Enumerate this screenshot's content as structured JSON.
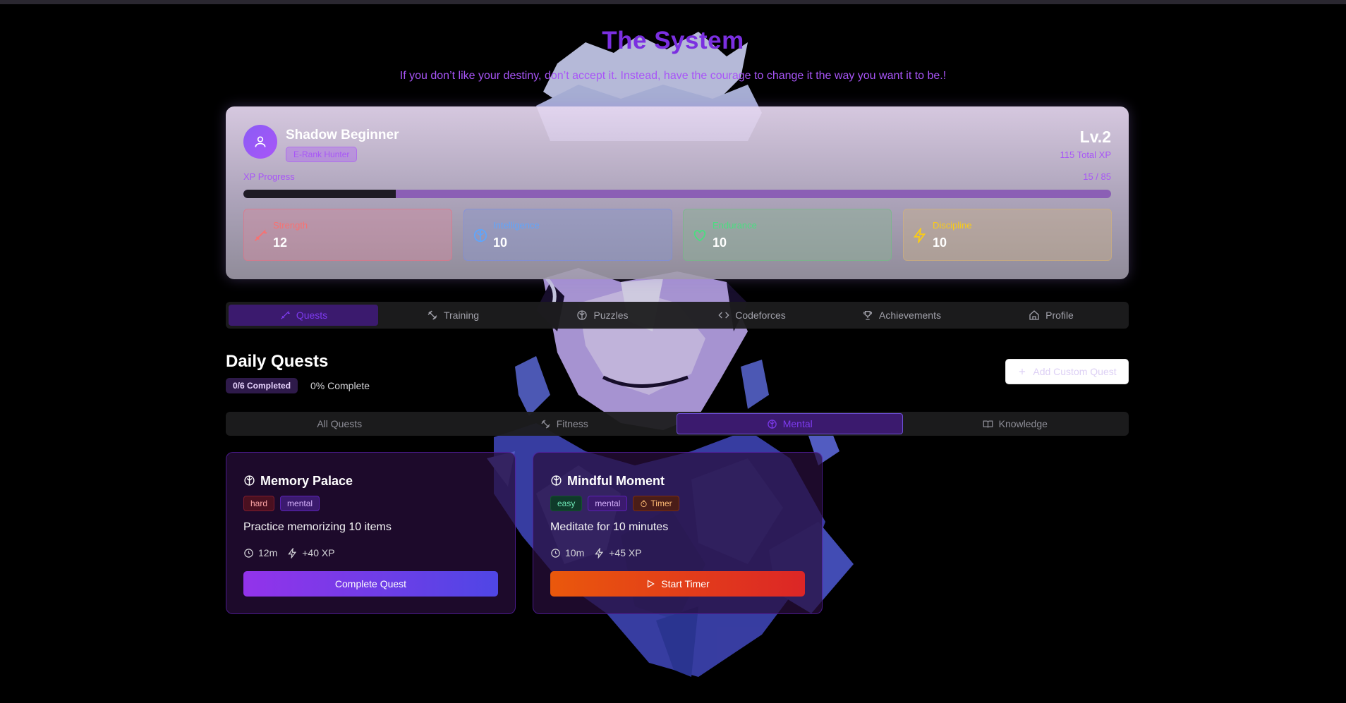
{
  "app": {
    "title": "The System",
    "subtitle": "If you don’t like your destiny, don’t accept it. Instead, have the courage to change it the way you want it to be.!"
  },
  "hunter": {
    "name": "Shadow Beginner",
    "rank": "E-Rank Hunter",
    "level": "Lv.2",
    "total_xp": "115 Total XP",
    "xp_label": "XP Progress",
    "xp_count": "15 / 85",
    "xp_progress": 0.176,
    "stats": [
      {
        "label": "Strength",
        "value": "12",
        "icon": "sword-icon",
        "color": "#f87171"
      },
      {
        "label": "Intelligence",
        "value": "10",
        "icon": "brain-icon",
        "color": "#60a5fa"
      },
      {
        "label": "Endurance",
        "value": "10",
        "icon": "heart-icon",
        "color": "#4ade80"
      },
      {
        "label": "Discipline",
        "value": "10",
        "icon": "lightning-icon",
        "color": "#facc15"
      }
    ]
  },
  "nav": {
    "tabs": [
      {
        "label": "Quests",
        "icon": "sword-icon",
        "active": true
      },
      {
        "label": "Training",
        "icon": "dumbbell-icon"
      },
      {
        "label": "Puzzles",
        "icon": "brain-icon"
      },
      {
        "label": "Codeforces",
        "icon": "code-icon"
      },
      {
        "label": "Achievements",
        "icon": "trophy-icon"
      },
      {
        "label": "Profile",
        "icon": "home-icon"
      }
    ]
  },
  "quests": {
    "heading": "Daily Quests",
    "completed_badge": "0/6 Completed",
    "complete_pct": "0% Complete",
    "add_button": "Add Custom Quest",
    "filters": [
      {
        "label": "All Quests"
      },
      {
        "label": "Fitness",
        "icon": "dumbbell-icon"
      },
      {
        "label": "Mental",
        "icon": "brain-icon",
        "active": true
      },
      {
        "label": "Knowledge",
        "icon": "book-icon"
      }
    ],
    "items": [
      {
        "title": "Memory Palace",
        "tags": [
          "hard",
          "mental"
        ],
        "description": "Practice memorizing 10 items",
        "time": "12m",
        "xp": "+40 XP",
        "button": "Complete Quest"
      },
      {
        "title": "Mindful Moment",
        "tags": [
          "easy",
          "mental",
          "Timer"
        ],
        "description": "Meditate for 10 minutes",
        "time": "10m",
        "xp": "+45 XP",
        "button": "Start Timer"
      }
    ]
  },
  "colors": {
    "accent": "#7c3aed",
    "title": "#7b2fe0",
    "subtitle": "#a855f7"
  }
}
